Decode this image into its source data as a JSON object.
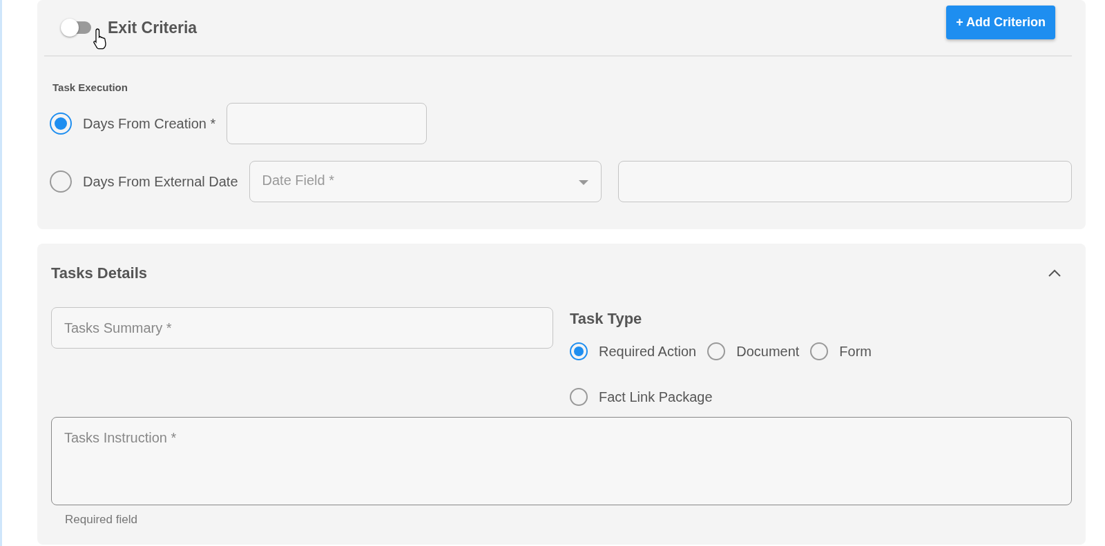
{
  "exit_criteria": {
    "toggle_on": false,
    "title": "Exit Criteria",
    "add_button": "+ Add Criterion"
  },
  "task_execution": {
    "label": "Task Execution",
    "options": [
      {
        "kind": "number",
        "label": "Days From Creation *",
        "selected": true
      },
      {
        "kind": "date",
        "label": "Days From External Date",
        "selected": false,
        "date_field": {
          "placeholder": "Date Field *"
        }
      }
    ]
  },
  "tasks_details": {
    "title": "Tasks Details",
    "expanded": true,
    "summary": {
      "placeholder": "Tasks Summary *"
    },
    "task_type": {
      "label": "Task Type",
      "options": [
        {
          "label": "Required Action",
          "selected": true
        },
        {
          "label": "Document",
          "selected": false
        },
        {
          "label": "Form",
          "selected": false
        },
        {
          "label": "Fact Link Package",
          "selected": false
        }
      ]
    },
    "instruction": {
      "placeholder": "Tasks Instruction *",
      "helper": "Required field"
    }
  }
}
